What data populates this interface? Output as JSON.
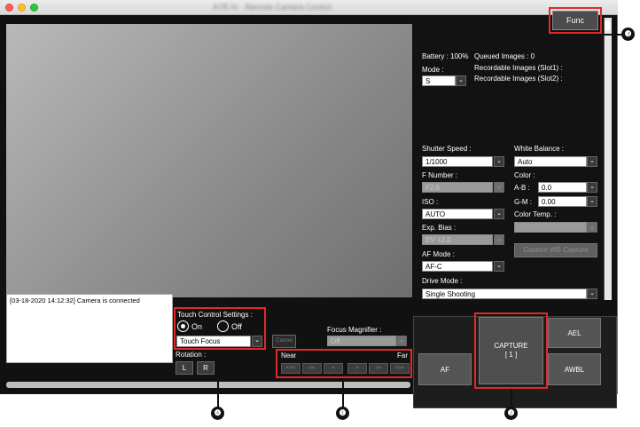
{
  "window": {
    "title": "A7R IV · Remote Camera Control"
  },
  "live_view": {
    "description": ""
  },
  "status": {
    "battery": "Battery : 100%",
    "queued": "Queued Images : 0",
    "slot1": "Recordable Images (Slot1) :",
    "slot2": "Recordable Images (Slot2) :"
  },
  "func_button": "Func",
  "mode": {
    "label": "Mode :",
    "value": "S"
  },
  "settings": {
    "shutter_speed": {
      "label": "Shutter Speed :",
      "value": "1/1000"
    },
    "f_number": {
      "label": "F Number :",
      "value": "F2.8"
    },
    "iso": {
      "label": "ISO :",
      "value": "AUTO"
    },
    "exp_bias": {
      "label": "Exp. Bias :",
      "value": "EV +2.0"
    },
    "af_mode": {
      "label": "AF Mode :",
      "value": "AF-C"
    },
    "drive_mode": {
      "label": "Drive Mode :",
      "value": "Single Shooting"
    },
    "white_balance": {
      "label": "White Balance :",
      "value": "Auto"
    },
    "color": {
      "label": "Color :"
    },
    "ab": {
      "label": "A-B :",
      "value": "0.0"
    },
    "gm": {
      "label": "G-M :",
      "value": "0.00"
    },
    "color_temp": {
      "label": "Color Temp. :",
      "value": ""
    },
    "custom_wb": "Custom WB Capture"
  },
  "log": {
    "text": "[03-18-2020 14:12:32] Camera is connected"
  },
  "touch_control": {
    "label": "Touch Control Settings :",
    "on": "On",
    "off": "Off",
    "selected": "On",
    "mode": "Touch Focus",
    "cancel": "Cancel"
  },
  "rotation": {
    "label": "Rotation :",
    "left": "L",
    "right": "R"
  },
  "focus_magnifier": {
    "label": "Focus Magnifier :",
    "value": "Off"
  },
  "focus": {
    "near": "Near",
    "far": "Far",
    "buttons": [
      "<<<",
      "<<",
      "<",
      ">",
      ">>",
      ">>>"
    ]
  },
  "capture": {
    "af": "AF",
    "capture_label": "CAPTURE",
    "capture_count": "[ 1 ]",
    "ael": "AEL",
    "awbl": "AWBL"
  },
  "callouts": [
    "❸",
    "❷",
    "❹",
    "❶"
  ],
  "colors": {
    "highlight": "#e02a2a",
    "panel_bg": "#121212"
  }
}
